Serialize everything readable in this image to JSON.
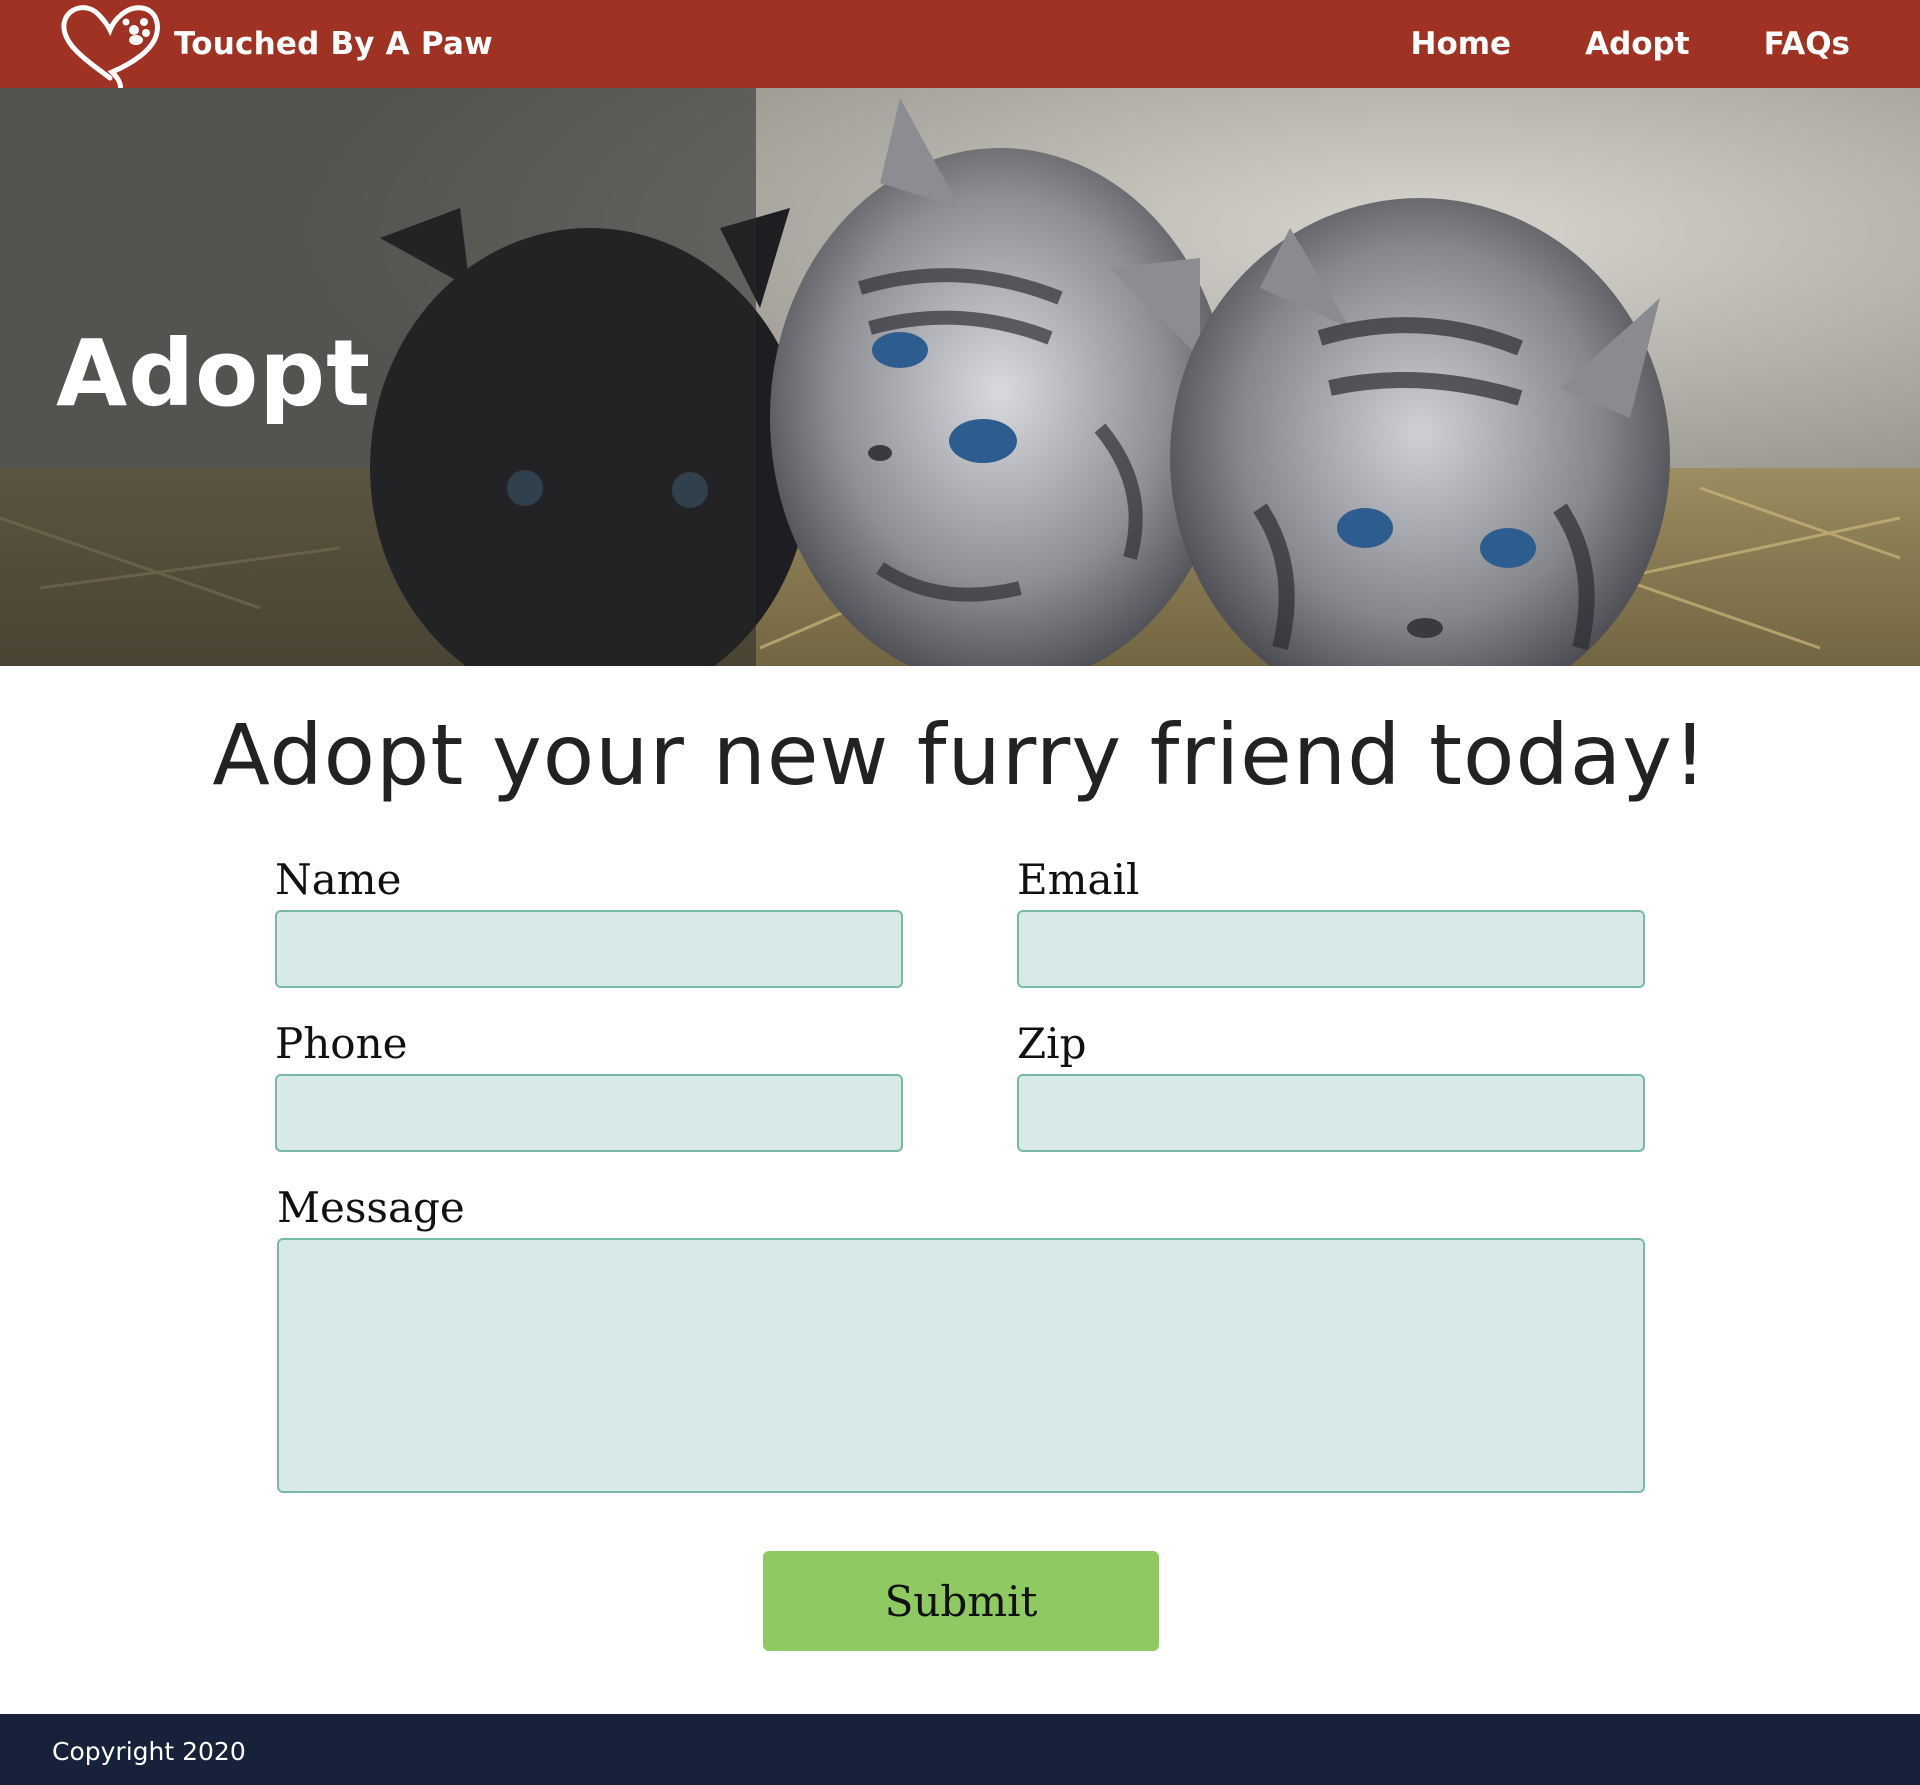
{
  "nav": {
    "brand": "Touched By A Paw",
    "links": [
      {
        "label": "Home"
      },
      {
        "label": "Adopt"
      },
      {
        "label": "FAQs"
      }
    ],
    "background": "#a03224"
  },
  "hero": {
    "title": "Adopt"
  },
  "main": {
    "headline": "Adopt your new furry friend today!",
    "form": {
      "name_label": "Name",
      "email_label": "Email",
      "phone_label": "Phone",
      "zip_label": "Zip",
      "message_label": "Message",
      "name_value": "",
      "email_value": "",
      "phone_value": "",
      "zip_value": "",
      "message_value": "",
      "submit_label": "Submit",
      "field_color": "#d8eae8",
      "submit_color": "#8ec962"
    }
  },
  "footer": {
    "copyright": "Copyright 2020",
    "background": "#18213a"
  }
}
